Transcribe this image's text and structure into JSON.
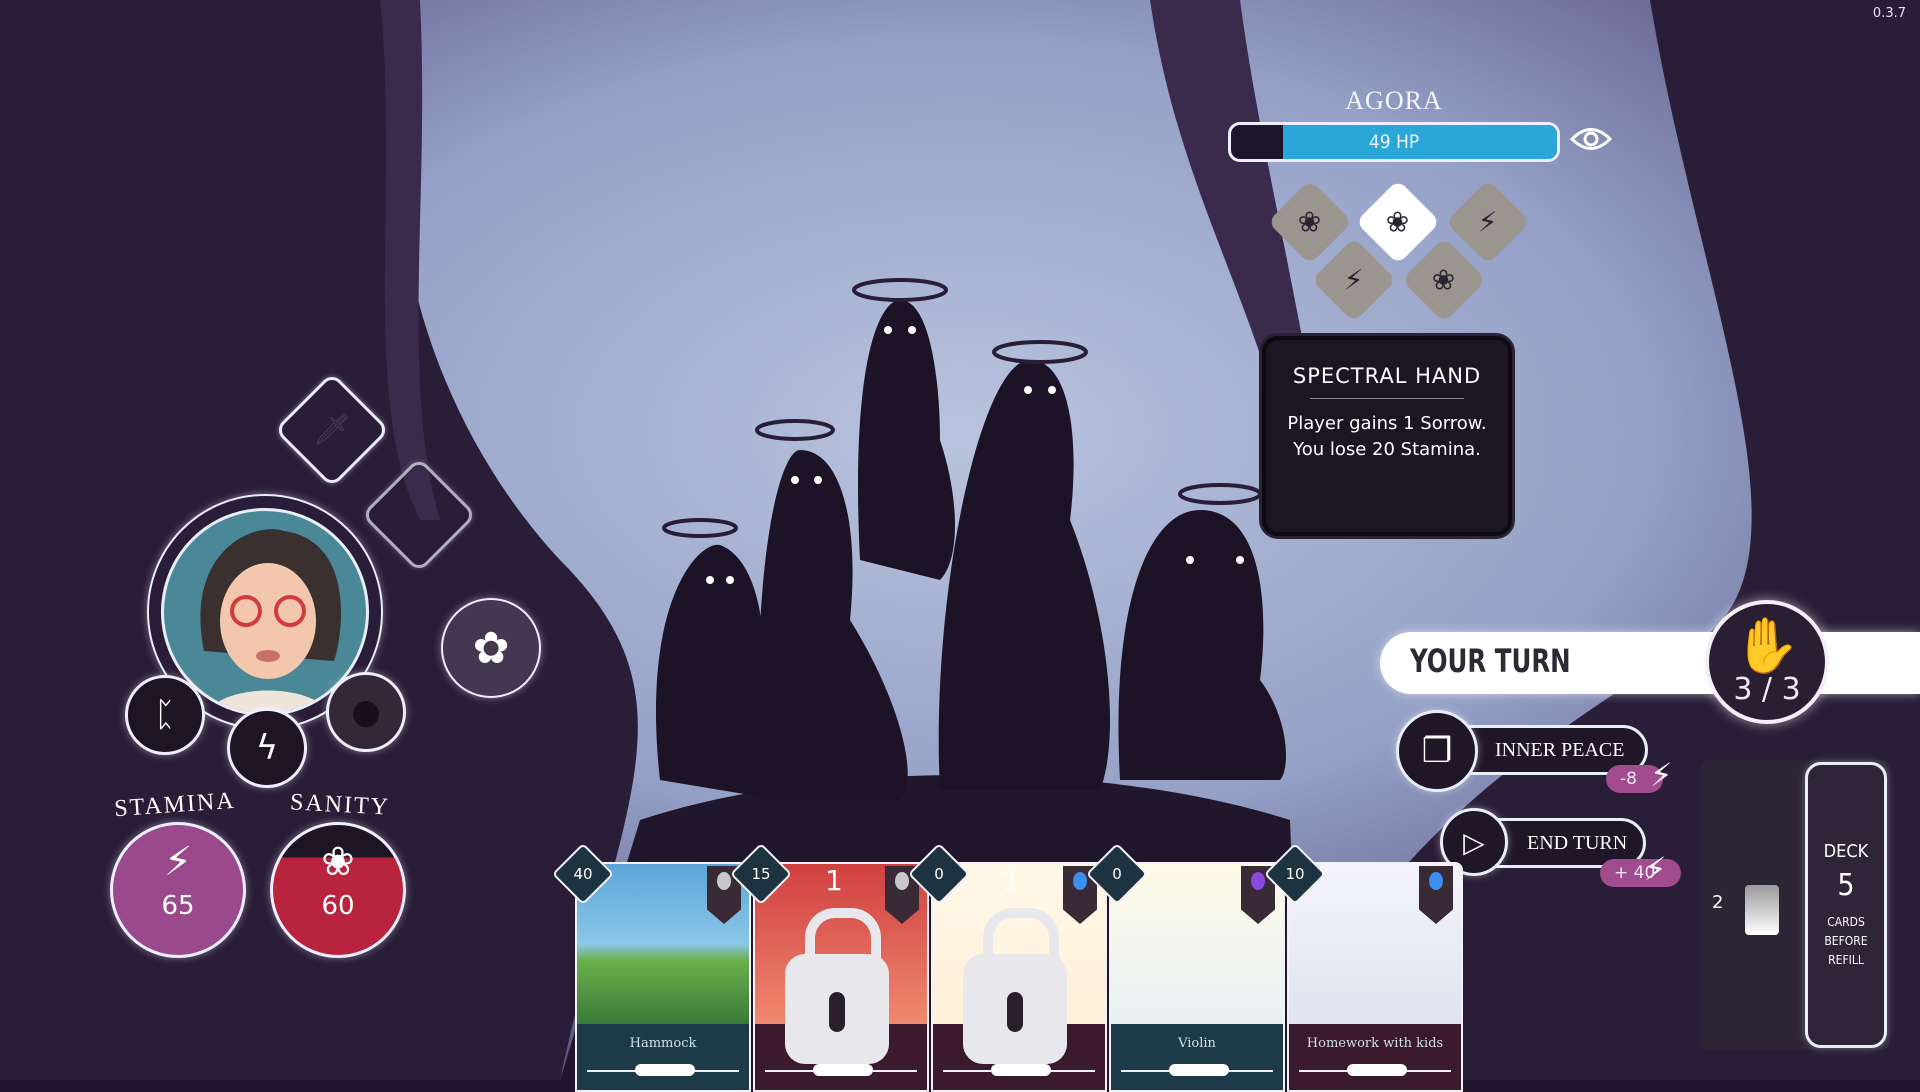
{
  "version": "0.3.7",
  "enemy": {
    "name": "AGORA",
    "hp_label": "49 HP",
    "hp_fraction": 0.84,
    "hp_color": "#2aa6d8",
    "intents": [
      {
        "icon": "brain-down-icon",
        "active": false
      },
      {
        "icon": "brain-down-icon",
        "active": true
      },
      {
        "icon": "bolt-down-icon",
        "active": false
      },
      {
        "icon": "bolt-down-icon",
        "active": false
      },
      {
        "icon": "brain-down-icon",
        "active": false
      }
    ],
    "tooltip": {
      "title": "SPECTRAL HAND",
      "body": "Player gains 1 Sorrow. You lose 20 Stamina."
    }
  },
  "turn": {
    "label": "YOUR TURN",
    "hand_count": "3 / 3"
  },
  "actions": {
    "inner_peace": {
      "label": "INNER PEACE",
      "cost": "-8"
    },
    "end_turn": {
      "label": "END TURN",
      "gain": "+ 40"
    }
  },
  "deck": {
    "discard_count": "2",
    "title": "DECK",
    "count": "5",
    "caption": "CARDS BEFORE REFILL"
  },
  "player": {
    "stamina": {
      "label": "STAMINA",
      "value": "65",
      "color": "#9a4a8c"
    },
    "sanity": {
      "label": "SANITY",
      "value": "60",
      "color": "#b8243e",
      "fill_fraction": 0.75
    },
    "flower_counter": "1"
  },
  "hand": [
    {
      "name": "Hammock",
      "cost": "40",
      "locked": false,
      "gem": "#c8c8cc"
    },
    {
      "name": "",
      "cost": "15",
      "locked": true,
      "lock_number": "1",
      "gem": "#c8c8cc"
    },
    {
      "name": "",
      "cost": "0",
      "locked": true,
      "lock_number": "1",
      "gem": "#3c8ef0"
    },
    {
      "name": "Violin",
      "cost": "0",
      "locked": false,
      "gem": "#8a4ae0"
    },
    {
      "name": "Homework with kids",
      "cost": "10",
      "locked": false,
      "gem": "#3c8ef0"
    }
  ]
}
